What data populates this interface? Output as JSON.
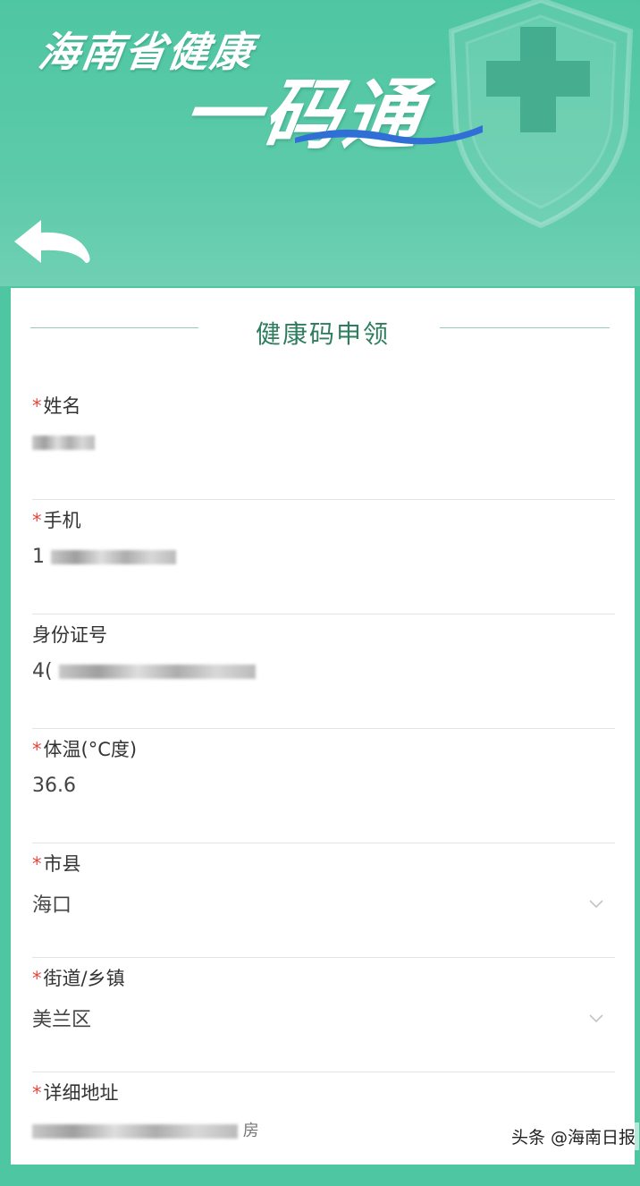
{
  "header": {
    "title_line1": "海南省健康",
    "title_line2": "一码通"
  },
  "form": {
    "title": "健康码申领",
    "fields": [
      {
        "label": "姓名",
        "required": true,
        "value": ""
      },
      {
        "label": "手机",
        "required": true,
        "value_prefix": "1"
      },
      {
        "label": "身份证号",
        "required": false,
        "value_prefix": "4("
      },
      {
        "label": "体温(°C度)",
        "required": true,
        "value": "36.6"
      },
      {
        "label": "市县",
        "required": true,
        "value": "海口"
      },
      {
        "label": "街道/乡镇",
        "required": true,
        "value": "美兰区"
      },
      {
        "label": "详细地址",
        "required": true,
        "value_suffix": "房"
      }
    ],
    "required_mark": "*"
  },
  "watermark": "头条 @海南日报",
  "colors": {
    "header_green": "#4fc6a2",
    "title_green": "#2e7d5f",
    "required_red": "#e2463f"
  },
  "icons": {
    "back": "back-arrow-icon",
    "dropdown": "chevron-down-icon",
    "shield": "shield-cross-icon"
  }
}
